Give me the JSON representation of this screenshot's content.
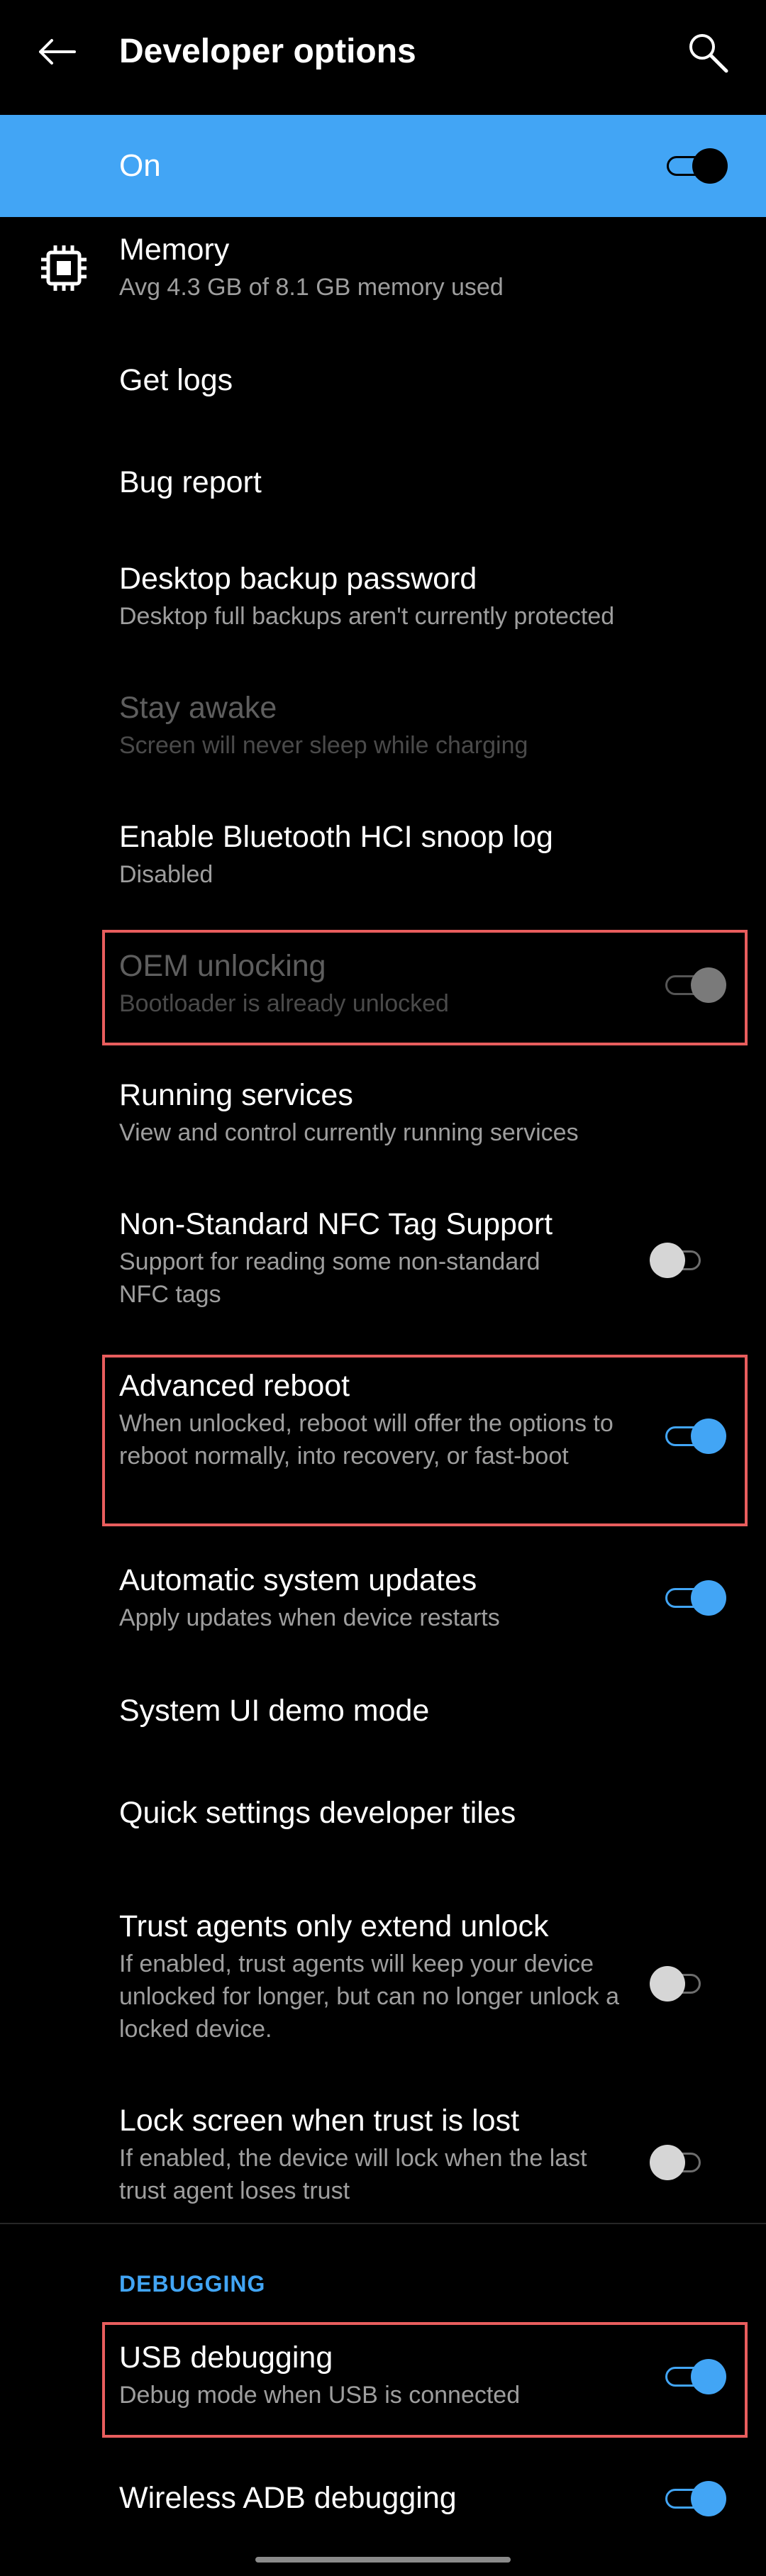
{
  "app_bar": {
    "title": "Developer options",
    "back_icon": "arrow-left-icon",
    "search_icon": "search-icon"
  },
  "master_switch": {
    "label": "On",
    "state": "on"
  },
  "items": {
    "memory": {
      "title": "Memory",
      "summary": "Avg 4.3 GB of 8.1 GB memory used",
      "icon": "memory-chip-icon"
    },
    "get_logs": {
      "title": "Get logs"
    },
    "bug_report": {
      "title": "Bug report"
    },
    "desktop_backup": {
      "title": "Desktop backup password",
      "summary": "Desktop full backups aren't currently protected"
    },
    "stay_awake": {
      "title": "Stay awake",
      "summary": "Screen will never sleep while charging",
      "enabled": false
    },
    "bt_hci": {
      "title": "Enable Bluetooth HCI snoop log",
      "summary": "Disabled"
    },
    "oem_unlocking": {
      "title": "OEM unlocking",
      "summary": "Bootloader is already unlocked",
      "enabled": false,
      "state": "on"
    },
    "running_services": {
      "title": "Running services",
      "summary": "View and control currently running services"
    },
    "nfc_tag": {
      "title": "Non-Standard NFC Tag Support",
      "summary": "Support for reading some non-standard NFC tags",
      "state": "off"
    },
    "advanced_reboot": {
      "title": "Advanced reboot",
      "summary": "When unlocked, reboot will offer the options to reboot normally, into recovery, or fast-boot",
      "state": "on"
    },
    "auto_updates": {
      "title": "Automatic system updates",
      "summary": "Apply updates when device restarts",
      "state": "on"
    },
    "demo_mode": {
      "title": "System UI demo mode"
    },
    "qs_tiles": {
      "title": "Quick settings developer tiles"
    },
    "trust_agents": {
      "title": "Trust agents only extend unlock",
      "summary": "If enabled, trust agents will keep your device unlocked for longer, but can no longer unlock a locked device.",
      "state": "off"
    },
    "lock_screen_trust": {
      "title": "Lock screen when trust is lost",
      "summary": "If enabled, the device will lock when the last trust agent loses trust",
      "state": "off"
    }
  },
  "debugging": {
    "header": "DEBUGGING",
    "usb_debugging": {
      "title": "USB debugging",
      "summary": "Debug mode when USB is connected",
      "state": "on"
    },
    "wireless_adb": {
      "title": "Wireless ADB debugging",
      "state": "on"
    }
  },
  "colors": {
    "accent": "#42a5f5",
    "highlight": "#e85d5d",
    "background": "#000000"
  }
}
